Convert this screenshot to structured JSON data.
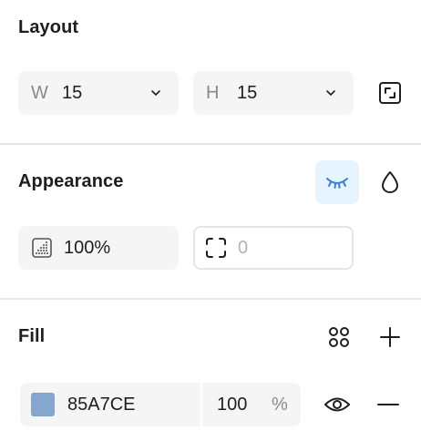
{
  "layout": {
    "title": "Layout",
    "width_label": "W",
    "width_value": "15",
    "height_label": "H",
    "height_value": "15"
  },
  "appearance": {
    "title": "Appearance",
    "opacity_value": "100%",
    "corner_radius_value": "0"
  },
  "fill": {
    "title": "Fill",
    "hex_value": "85A7CE",
    "opacity_value": "100",
    "percent_symbol": "%"
  },
  "colors": {
    "fill_swatch": "#85A7CE",
    "active_accent": "#3b7fd9",
    "active_bg": "#e5f4ff",
    "field_bg": "#f5f5f5",
    "divider": "#e6e6e6"
  },
  "icons": {
    "resize": "resize-to-fit-icon",
    "visibility_hidden": "eye-closed-icon",
    "blend": "drop-icon",
    "opacity": "opacity-icon",
    "corner_radius": "corner-radius-icon",
    "styles": "styles-grid-icon",
    "add": "plus-icon",
    "visibility": "eye-icon",
    "remove": "minus-icon"
  }
}
